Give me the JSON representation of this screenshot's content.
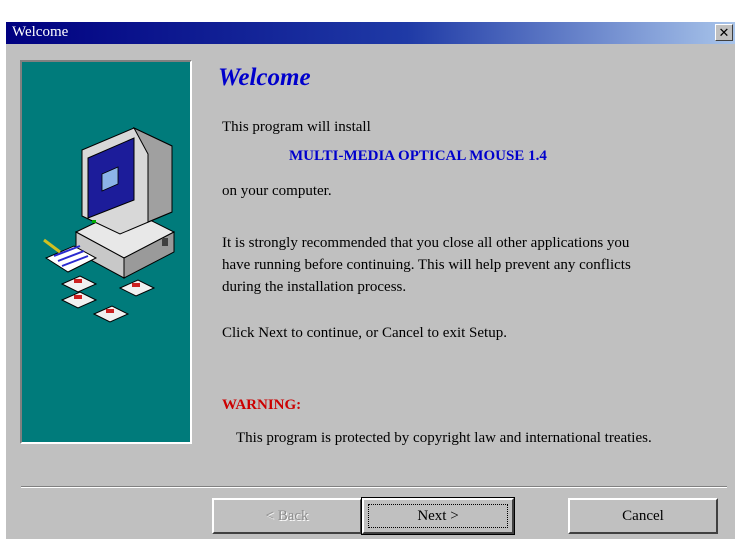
{
  "window": {
    "title": "Welcome",
    "close_icon": "close-icon"
  },
  "main": {
    "heading": "Welcome",
    "intro": "This program will install",
    "product": "MULTI-MEDIA OPTICAL MOUSE 1.4",
    "location": "on your computer.",
    "recommend_lines": [
      "It is strongly recommended that you close all other applications you",
      "have running before continuing. This will help prevent any conflicts",
      "during the installation process."
    ],
    "instruction": "Click Next to continue, or Cancel to exit Setup.",
    "warning_label": "WARNING:",
    "warning_text": "This program is protected by copyright law and international treaties."
  },
  "illustration": {
    "name": "computer-with-disks-illustration",
    "panel_color": "#007b7b"
  },
  "buttons": {
    "back": "< Back",
    "next": "Next >",
    "cancel": "Cancel"
  },
  "colors": {
    "title_bar": "#000080",
    "heading": "#0000cc",
    "warning": "#cc0000",
    "dialog_face": "#c0c0c0"
  }
}
